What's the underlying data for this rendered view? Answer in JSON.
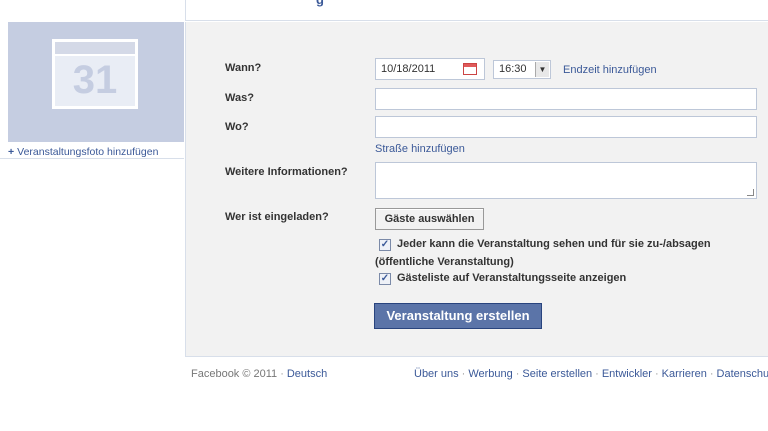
{
  "header": {
    "title_fragment": "g"
  },
  "photo": {
    "calendar_day": "31",
    "add_photo_label": "Veranstaltungsfoto hinzufügen"
  },
  "form": {
    "when_label": "Wann?",
    "date_value": "10/18/2011",
    "time_value": "16:30",
    "add_end_time": "Endzeit hinzufügen",
    "what_label": "Was?",
    "where_label": "Wo?",
    "add_street": "Straße hinzufügen",
    "more_info_label": "Weitere Informationen?",
    "invited_label": "Wer ist eingeladen?",
    "select_guests": "Gäste auswählen",
    "public_option_line1": "Jeder kann die Veranstaltung sehen und für sie zu-/absagen",
    "public_option_line2": "(öffentliche Veranstaltung)",
    "guestlist_option": "Gästeliste auf Veranstaltungsseite anzeigen",
    "create_button": "Veranstaltung erstellen",
    "check_mark": "✓"
  },
  "footer": {
    "copyright": "Facebook © 2011",
    "language": "Deutsch",
    "links": [
      "Über uns",
      "Werbung",
      "Seite erstellen",
      "Entwickler",
      "Karrieren",
      "Datenschutz"
    ]
  },
  "colors": {
    "accent": "#3b5998",
    "button": "#5b74a8",
    "panel": "#f2f2f2",
    "photo_bg": "#c5cde1"
  }
}
